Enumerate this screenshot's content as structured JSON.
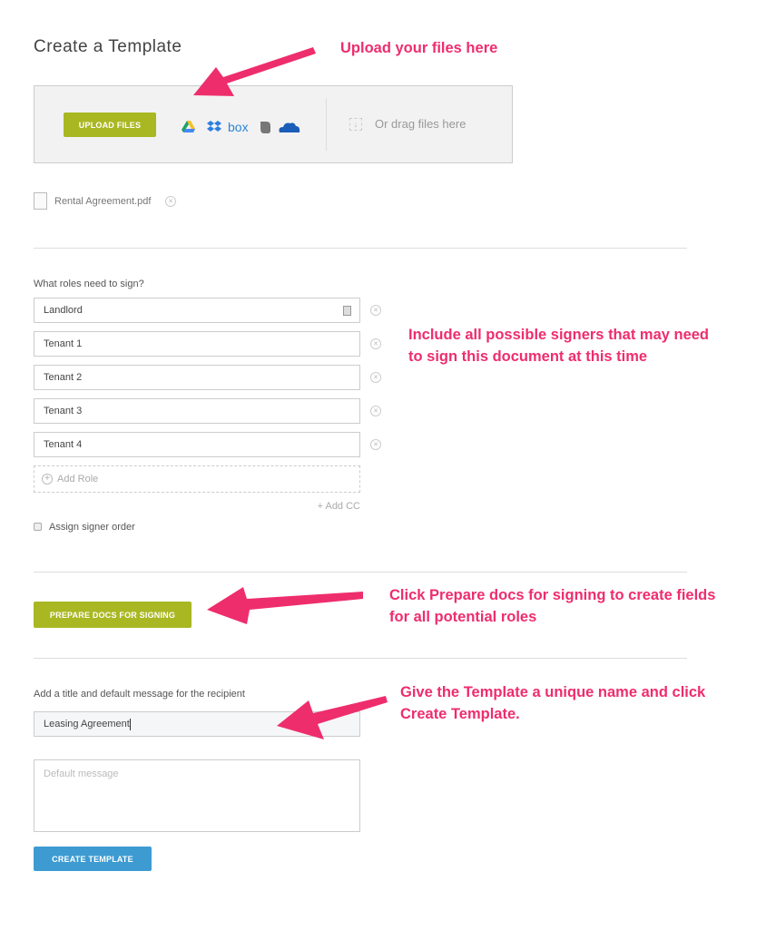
{
  "page": {
    "title": "Create a Template"
  },
  "upload": {
    "button_label": "UPLOAD FILES",
    "services": [
      "google-drive-icon",
      "dropbox-icon",
      "box-icon",
      "evernote-icon",
      "onedrive-icon"
    ],
    "box_text": "box",
    "drag_text": "Or drag files here"
  },
  "file": {
    "name": "Rental Agreement.pdf"
  },
  "roles": {
    "label": "What roles need to sign?",
    "items": [
      "Landlord",
      "Tenant 1",
      "Tenant 2",
      "Tenant 3",
      "Tenant 4"
    ],
    "add_role": "Add Role",
    "add_cc": "+ Add CC",
    "signer_order_label": "Assign signer order"
  },
  "prepare": {
    "button_label": "PREPARE DOCS FOR SIGNING"
  },
  "message": {
    "label": "Add a title and default message for the recipient",
    "title_value": "Leasing Agreement",
    "message_placeholder": "Default message",
    "create_label": "CREATE TEMPLATE"
  },
  "annotations": {
    "upload": "Upload your files here",
    "signers": [
      "Include all possible signers that may need",
      "to sign this document at this time"
    ],
    "prepare": [
      "Click Prepare docs for signing to create fields",
      "for all potential roles"
    ],
    "create": [
      "Give the Template a unique name and click",
      "Create Template."
    ]
  },
  "colors": {
    "green": "#a9b722",
    "blue": "#3d9bd2",
    "annotation": "#ee2d6d"
  }
}
